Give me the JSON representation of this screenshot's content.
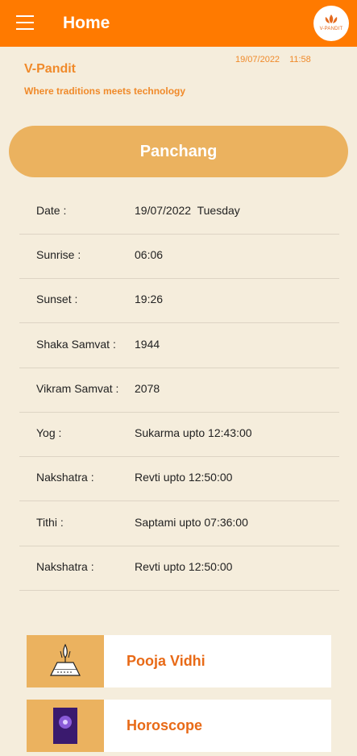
{
  "appbar": {
    "title": "Home",
    "logo_text": "V-PANDIT"
  },
  "brand": {
    "name": "V-Pandit",
    "tagline": "Where traditions meets technology"
  },
  "datetime": {
    "date": "19/07/2022",
    "time": "11:58"
  },
  "panchang_button": "Panchang",
  "panchang_rows": [
    {
      "label": "Date :",
      "value": "19/07/2022  Tuesday"
    },
    {
      "label": "Sunrise :",
      "value": "06:06"
    },
    {
      "label": "Sunset :",
      "value": "19:26"
    },
    {
      "label": "Shaka Samvat :",
      "value": "1944"
    },
    {
      "label": "Vikram Samvat :",
      "value": "2078"
    },
    {
      "label": "Yog :",
      "value": "Sukarma upto 12:43:00"
    },
    {
      "label": "Nakshatra :",
      "value": "Revti upto 12:50:00"
    },
    {
      "label": "Tithi :",
      "value": "Saptami upto 07:36:00"
    },
    {
      "label": "Nakshatra :",
      "value": "Revti upto 12:50:00"
    }
  ],
  "cards": [
    {
      "label": "Pooja Vidhi",
      "icon": "pooja-icon"
    },
    {
      "label": "Horoscope",
      "icon": "horoscope-icon"
    }
  ],
  "colors": {
    "appbar": "#FF7A00",
    "accent": "#F08A2A",
    "button": "#EBB25F",
    "background": "#F5EDDC"
  }
}
